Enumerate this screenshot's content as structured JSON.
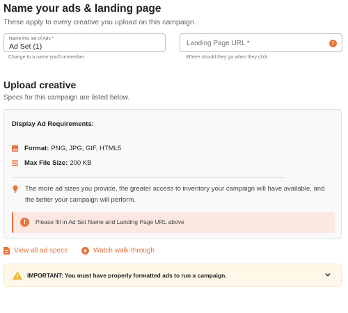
{
  "names_section": {
    "title": "Name your ads & landing page",
    "subtitle": "These apply to every creative you upload on this campaign.",
    "ad_set_field": {
      "label": "Name this set of Ads *",
      "value": "Ad Set (1)",
      "helper": "Change to a name you'll remember"
    },
    "landing_url_field": {
      "placeholder": "Landing Page URL *",
      "helper": "Where should they go when they click",
      "icon": "info-icon"
    }
  },
  "upload_section": {
    "title": "Upload creative",
    "subtitle": "Specs for this campaign are listed below.",
    "requirements": {
      "title": "Display Ad Requirements:",
      "format_label": "Format:",
      "format_value": "PNG, JPG, GIF, HTML5",
      "max_size_label": "Max File Size:",
      "max_size_value": "200 KB",
      "tip": "The more ad sizes you provide, the greater access to inventory your campaign will have available, and the better your campaign will perform.",
      "alert": "Please fill in Ad Set Name and Landing Page URL above"
    },
    "links": {
      "view_specs": "View all ad specs",
      "walkthrough": "Watch walk-through"
    },
    "important_banner": {
      "text": "IMPORTANT: You must have properly formatted ads to run a campaign."
    }
  },
  "colors": {
    "accent": "#e8743b",
    "alert_bg": "#fce8e1",
    "warning": "#f2b431",
    "important_bg": "#fff8e8"
  }
}
